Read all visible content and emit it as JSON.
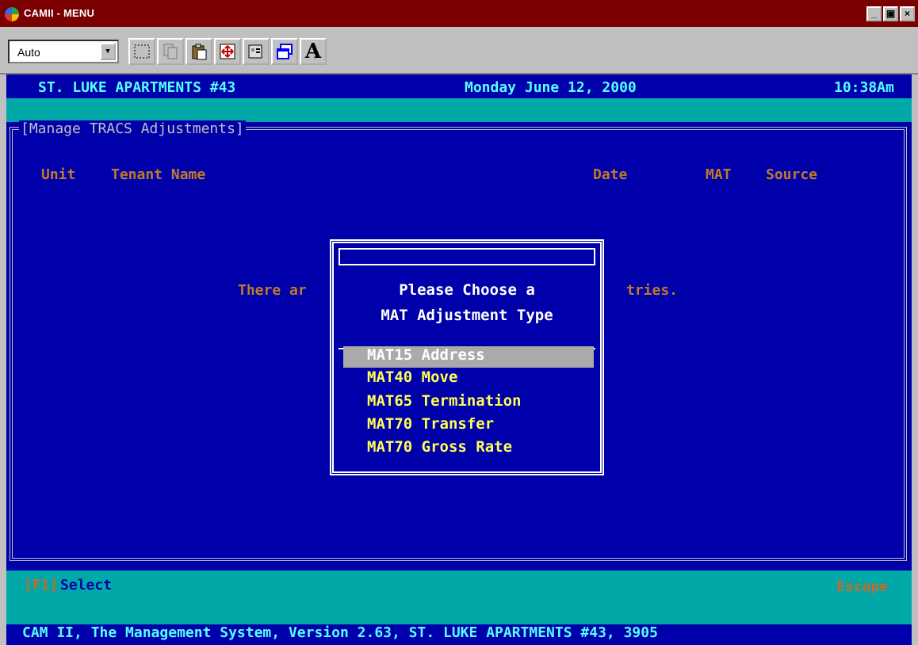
{
  "window": {
    "title": "CAMII - MENU",
    "controls": [
      "_",
      "▣",
      "×"
    ]
  },
  "toolbar": {
    "zoom_value": "Auto",
    "font_button": "A"
  },
  "header": {
    "property": "ST. LUKE APARTMENTS #43",
    "date": "Monday June 12, 2000",
    "time": "10:38Am"
  },
  "panel": {
    "title": "[Manage TRACS Adjustments]",
    "columns": [
      "Unit",
      "Tenant Name",
      "Date",
      "MAT",
      "Source"
    ],
    "empty_left": "There ar",
    "empty_right": "tries."
  },
  "popup": {
    "title_line1": "Please Choose a",
    "title_line2": "MAT Adjustment Type",
    "options": [
      "MAT15 Address",
      "MAT40 Move",
      "MAT65 Termination",
      "MAT70 Transfer",
      "MAT70 Gross Rate"
    ],
    "selected_index": 0
  },
  "footer": {
    "key": "[F1]",
    "select_label": "Select",
    "escape_label": "Escape",
    "status": "CAM II, The Management System, Version 2.63, ST. LUKE APARTMENTS #43, 3905"
  },
  "colors": {
    "dos_blue": "#0000aa",
    "cyan_bar": "#00a8a8",
    "header_cyan": "#55ffff",
    "orange_label": "#c07a2a",
    "menu_yellow": "#ffff55",
    "selection_gray": "#aaaaaa"
  }
}
